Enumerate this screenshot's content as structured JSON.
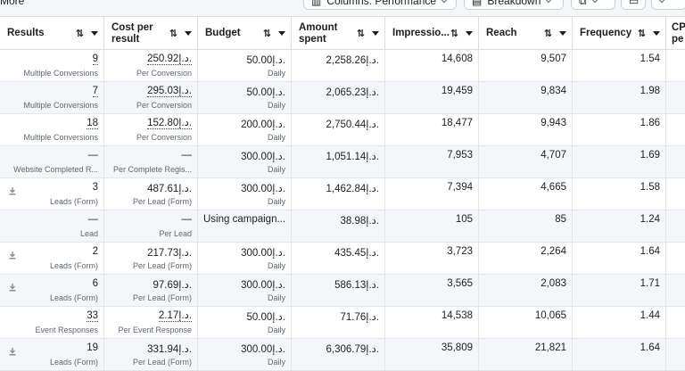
{
  "toolbar": {
    "more_label": "More",
    "columns_label": "Columns: Performance",
    "breakdown_label": "Breakdown"
  },
  "columns": [
    {
      "label": "Results"
    },
    {
      "label": "Cost per result"
    },
    {
      "label": "Budget"
    },
    {
      "label": "Amount spent"
    },
    {
      "label": "Impressio..."
    },
    {
      "label": "Reach"
    },
    {
      "label": "Frequency"
    },
    {
      "label": "CP pe"
    }
  ],
  "rows": [
    {
      "results": "9",
      "results_sub": "Multiple Conversions",
      "cost": "250.92د.إ.",
      "cost_sub": "Per Conversion",
      "budget": "50.00د.إ.",
      "budget_sub": "Daily",
      "spent": "2,258.26د.إ.",
      "impressions": "14,608",
      "reach": "9,507",
      "frequency": "1.54"
    },
    {
      "results": "7",
      "results_sub": "Multiple Conversions",
      "cost": "295.03د.إ.",
      "cost_sub": "Per Conversion",
      "budget": "50.00د.إ.",
      "budget_sub": "Daily",
      "spent": "2,065.23د.إ.",
      "impressions": "19,459",
      "reach": "9,834",
      "frequency": "1.98"
    },
    {
      "results": "18",
      "results_sub": "Multiple Conversions",
      "cost": "152.80د.إ.",
      "cost_sub": "Per Conversion",
      "budget": "200.00د.إ.",
      "budget_sub": "Daily",
      "spent": "2,750.44د.إ.",
      "impressions": "18,477",
      "reach": "9,943",
      "frequency": "1.86"
    },
    {
      "results": "—",
      "results_sub": "Website Completed R...",
      "cost": "—",
      "cost_sub": "Per Complete Regis...",
      "budget": "300.00د.إ.",
      "budget_sub": "Daily",
      "spent": "1,051.14د.إ.",
      "impressions": "7,953",
      "reach": "4,707",
      "frequency": "1.69"
    },
    {
      "results": "3",
      "results_sub": "Leads (Form)",
      "cost": "487.61د.إ.",
      "cost_sub": "Per Lead (Form)",
      "budget": "300.00د.إ.",
      "budget_sub": "Daily",
      "spent": "1,462.84د.إ.",
      "impressions": "7,394",
      "reach": "4,665",
      "frequency": "1.58"
    },
    {
      "results": "—",
      "results_sub": "Lead",
      "cost": "—",
      "cost_sub": "Per Lead",
      "budget": "Using campaign...",
      "budget_sub": "",
      "spent": "38.98د.إ.",
      "impressions": "105",
      "reach": "85",
      "frequency": "1.24"
    },
    {
      "results": "2",
      "results_sub": "Leads (Form)",
      "cost": "217.73د.إ.",
      "cost_sub": "Per Lead (Form)",
      "budget": "300.00د.إ.",
      "budget_sub": "Daily",
      "spent": "435.45د.إ.",
      "impressions": "3,723",
      "reach": "2,264",
      "frequency": "1.64"
    },
    {
      "results": "6",
      "results_sub": "Leads (Form)",
      "cost": "97.69د.إ.",
      "cost_sub": "Per Lead (Form)",
      "budget": "300.00د.إ.",
      "budget_sub": "Daily",
      "spent": "586.13د.إ.",
      "impressions": "3,565",
      "reach": "2,083",
      "frequency": "1.71"
    },
    {
      "results": "33",
      "results_sub": "Event Responses",
      "cost": "2.17د.إ.",
      "cost_sub": "Per Event Response",
      "budget": "50.00د.إ.",
      "budget_sub": "Daily",
      "spent": "71.76د.إ.",
      "impressions": "14,538",
      "reach": "10,065",
      "frequency": "1.44"
    },
    {
      "results": "19",
      "results_sub": "Leads (Form)",
      "cost": "331.94د.إ.",
      "cost_sub": "Per Lead (Form)",
      "budget": "300.00د.إ.",
      "budget_sub": "Daily",
      "spent": "6,306.79د.إ.",
      "impressions": "35,809",
      "reach": "21,821",
      "frequency": "1.64"
    }
  ]
}
